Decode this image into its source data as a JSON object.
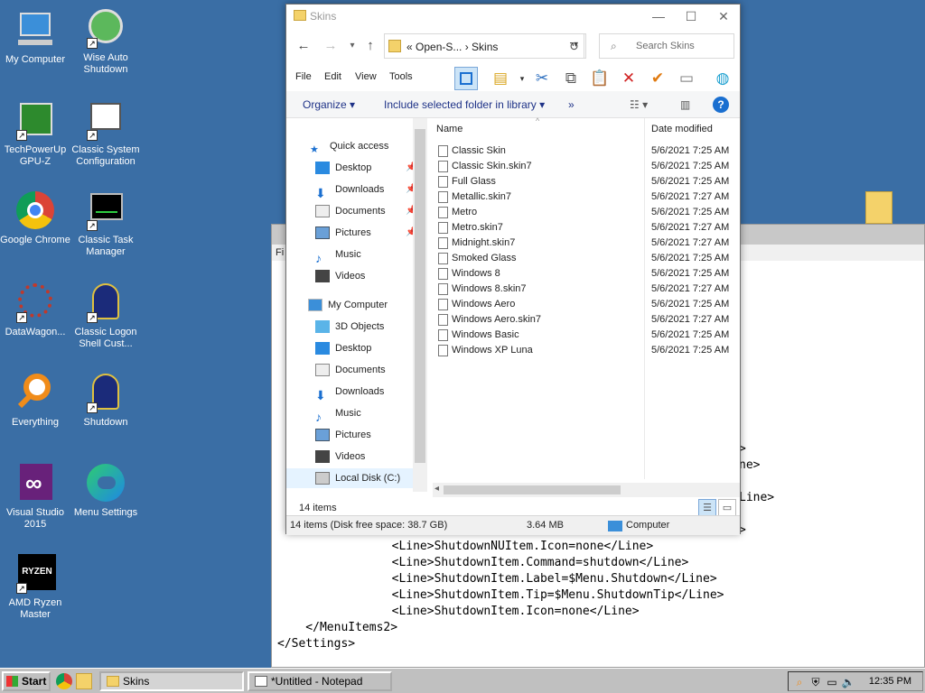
{
  "desktop": {
    "icons": [
      {
        "label": "My Computer"
      },
      {
        "label": "Wise Auto Shutdown"
      },
      {
        "label": "TechPowerUp GPU-Z"
      },
      {
        "label": "Classic System Configuration"
      },
      {
        "label": "Google Chrome"
      },
      {
        "label": "Classic Task Manager"
      },
      {
        "label": "DataWagon..."
      },
      {
        "label": "Classic Logon Shell Cust..."
      },
      {
        "label": "Everything"
      },
      {
        "label": "Shutdown"
      },
      {
        "label": "Visual Studio 2015"
      },
      {
        "label": "Menu Settings"
      },
      {
        "label": "AMD Ryzen Master"
      }
    ]
  },
  "notepad": {
    "menu_fragment": "Fi",
    "lines": [
      ">",
      "ne>",
      "",
      "Line>",
      "",
      ">",
      "        <Line>ShutdownNUItem.Icon=none</Line>",
      "        <Line>ShutdownItem.Command=shutdown</Line>",
      "        <Line>ShutdownItem.Label=$Menu.Shutdown</Line>",
      "        <Line>ShutdownItem.Tip=$Menu.ShutdownTip</Line>",
      "        <Line>ShutdownItem.Icon=none</Line>",
      "    </MenuItems2>",
      "</Settings>"
    ]
  },
  "explorer": {
    "title": "Skins",
    "address": {
      "crumbs": "« Open-S...  ›  Skins"
    },
    "search_placeholder": "Search Skins",
    "menus": [
      "File",
      "Edit",
      "View",
      "Tools"
    ],
    "commands": {
      "organize": "Organize ▾",
      "include": "Include selected folder in library ▾",
      "more": "»"
    },
    "columns": {
      "name": "Name",
      "date": "Date modified"
    },
    "nav": {
      "quick_access": "Quick access",
      "quick_items": [
        "Desktop",
        "Downloads",
        "Documents",
        "Pictures",
        "Music",
        "Videos"
      ],
      "my_computer": "My Computer",
      "computer_items": [
        "3D Objects",
        "Desktop",
        "Documents",
        "Downloads",
        "Music",
        "Pictures",
        "Videos",
        "Local Disk (C:)"
      ]
    },
    "files": [
      {
        "name": "Classic Skin",
        "date": "5/6/2021 7:25 AM"
      },
      {
        "name": "Classic Skin.skin7",
        "date": "5/6/2021 7:25 AM"
      },
      {
        "name": "Full Glass",
        "date": "5/6/2021 7:25 AM"
      },
      {
        "name": "Metallic.skin7",
        "date": "5/6/2021 7:27 AM"
      },
      {
        "name": "Metro",
        "date": "5/6/2021 7:25 AM"
      },
      {
        "name": "Metro.skin7",
        "date": "5/6/2021 7:27 AM"
      },
      {
        "name": "Midnight.skin7",
        "date": "5/6/2021 7:27 AM"
      },
      {
        "name": "Smoked Glass",
        "date": "5/6/2021 7:25 AM"
      },
      {
        "name": "Windows 8",
        "date": "5/6/2021 7:25 AM"
      },
      {
        "name": "Windows 8.skin7",
        "date": "5/6/2021 7:27 AM"
      },
      {
        "name": "Windows Aero",
        "date": "5/6/2021 7:25 AM"
      },
      {
        "name": "Windows Aero.skin7",
        "date": "5/6/2021 7:27 AM"
      },
      {
        "name": "Windows Basic",
        "date": "5/6/2021 7:25 AM"
      },
      {
        "name": "Windows XP Luna",
        "date": "5/6/2021 7:25 AM"
      }
    ],
    "item_count": "14 items",
    "status": {
      "left": "14 items (Disk free space: 38.7 GB)",
      "size": "3.64 MB",
      "location": "Computer"
    }
  },
  "taskbar": {
    "start": "Start",
    "tasks": [
      "Skins",
      "*Untitled - Notepad"
    ],
    "clock": "12:35 PM"
  }
}
